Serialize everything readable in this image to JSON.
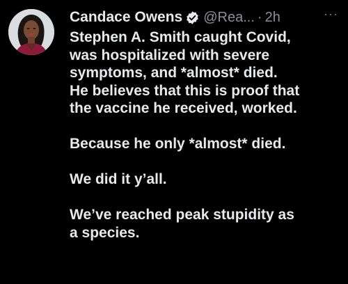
{
  "tweet": {
    "author_name": "Candace Owens",
    "handle": "@Rea...",
    "separator": "·",
    "time": "2h",
    "more_label": "···",
    "verified_icon": "verified-badge-icon",
    "colors": {
      "background": "#000000",
      "text": "#e7e9ea",
      "secondary_text": "#8b9095",
      "verified": "#1d9bf0"
    },
    "paragraphs": [
      {
        "lines": [
          "Stephen A. Smith caught Covid,",
          "was hospitalized with severe",
          "symptoms, and *almost* died.",
          "He believes that this is proof that",
          "the vaccine he received, worked."
        ]
      },
      {
        "lines": [
          "Because he only *almost* died."
        ]
      },
      {
        "lines": [
          "We did it y’all."
        ]
      },
      {
        "lines": [
          "We’ve reached peak stupidity as",
          "a species."
        ]
      }
    ]
  }
}
